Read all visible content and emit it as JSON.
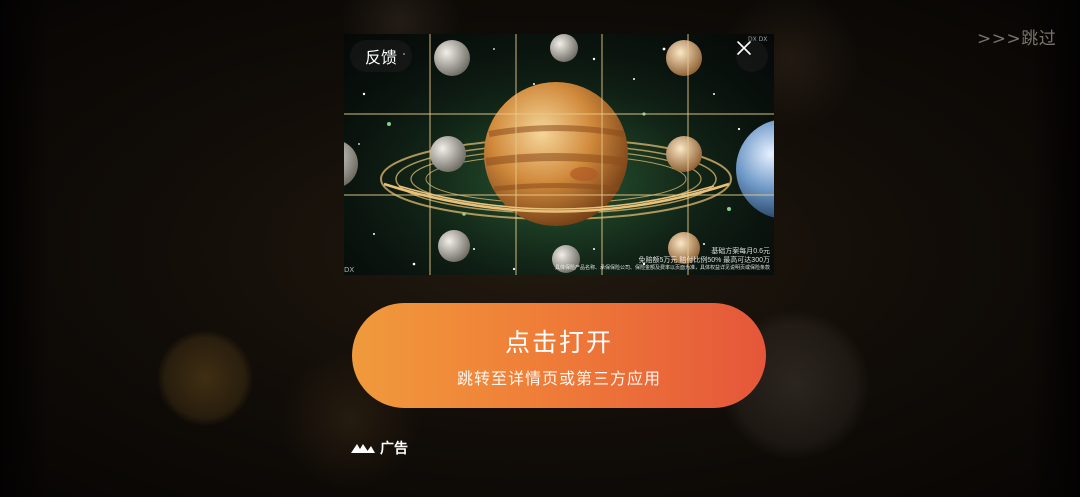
{
  "skip_label": ">>>跳过",
  "ad": {
    "feedback_label": "反馈",
    "watermark_top": "DX DX",
    "watermark_left": "DX",
    "fine_print": {
      "line1": "基础方案每月0.6元",
      "line2": "免赔额5万元 赔付比例50% 最高可达300万",
      "line3": "具体保险产品名称、承保保险公司、保险金额及费率以页面为准，具体权益详见说明页或保险条款"
    }
  },
  "cta": {
    "title": "点击打开",
    "subtitle": "跳转至详情页或第三方应用"
  },
  "ad_badge": {
    "label": "广告"
  },
  "colors": {
    "cta_start": "#f09a3c",
    "cta_end": "#e5563a",
    "skip_text": "#7a736a"
  }
}
